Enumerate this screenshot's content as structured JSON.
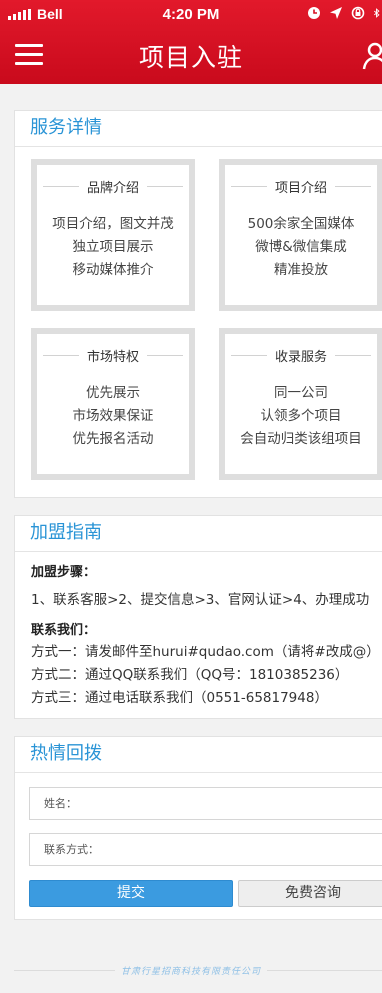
{
  "status_bar": {
    "carrier": "Bell",
    "time": "4:20 PM"
  },
  "nav": {
    "title": "项目入驻",
    "left_icon": "hamburger-menu-icon",
    "right_icon": "user-icon"
  },
  "service": {
    "title": "服务详情",
    "cards": [
      {
        "title": "品牌介绍",
        "lines": [
          "项目介绍，图文并茂",
          "独立项目展示",
          "移动媒体推介"
        ]
      },
      {
        "title": "项目介绍",
        "lines": [
          "500余家全国媒体",
          "微博&微信集成",
          "精准投放"
        ]
      },
      {
        "title": "市场特权",
        "lines": [
          "优先展示",
          "市场效果保证",
          "优先报名活动"
        ]
      },
      {
        "title": "收录服务",
        "lines": [
          "同一公司",
          "认领多个项目",
          "会自动归类该组项目"
        ]
      }
    ]
  },
  "guide": {
    "title": "加盟指南",
    "steps_label": "加盟步骤：",
    "steps": "1、联系客服>2、提交信息>3、官网认证>4、办理成功",
    "contact_label": "联系我们：",
    "contacts": [
      "方式一：请发邮件至hurui#qudao.com（请将#改成@）",
      "方式二：通过QQ联系我们（QQ号：1810385236）",
      "方式三：通过电话联系我们（0551-65817948）"
    ]
  },
  "callback": {
    "title": "热情回拨",
    "name_label": "姓名：",
    "contact_label": "联系方式：",
    "submit_label": "提交",
    "consult_label": "免费咨询"
  },
  "footer": {
    "text": "甘肃行星招商科技有限责任公司"
  },
  "colors": {
    "brand_red": "#d51022",
    "accent_blue": "#2a94d6"
  }
}
